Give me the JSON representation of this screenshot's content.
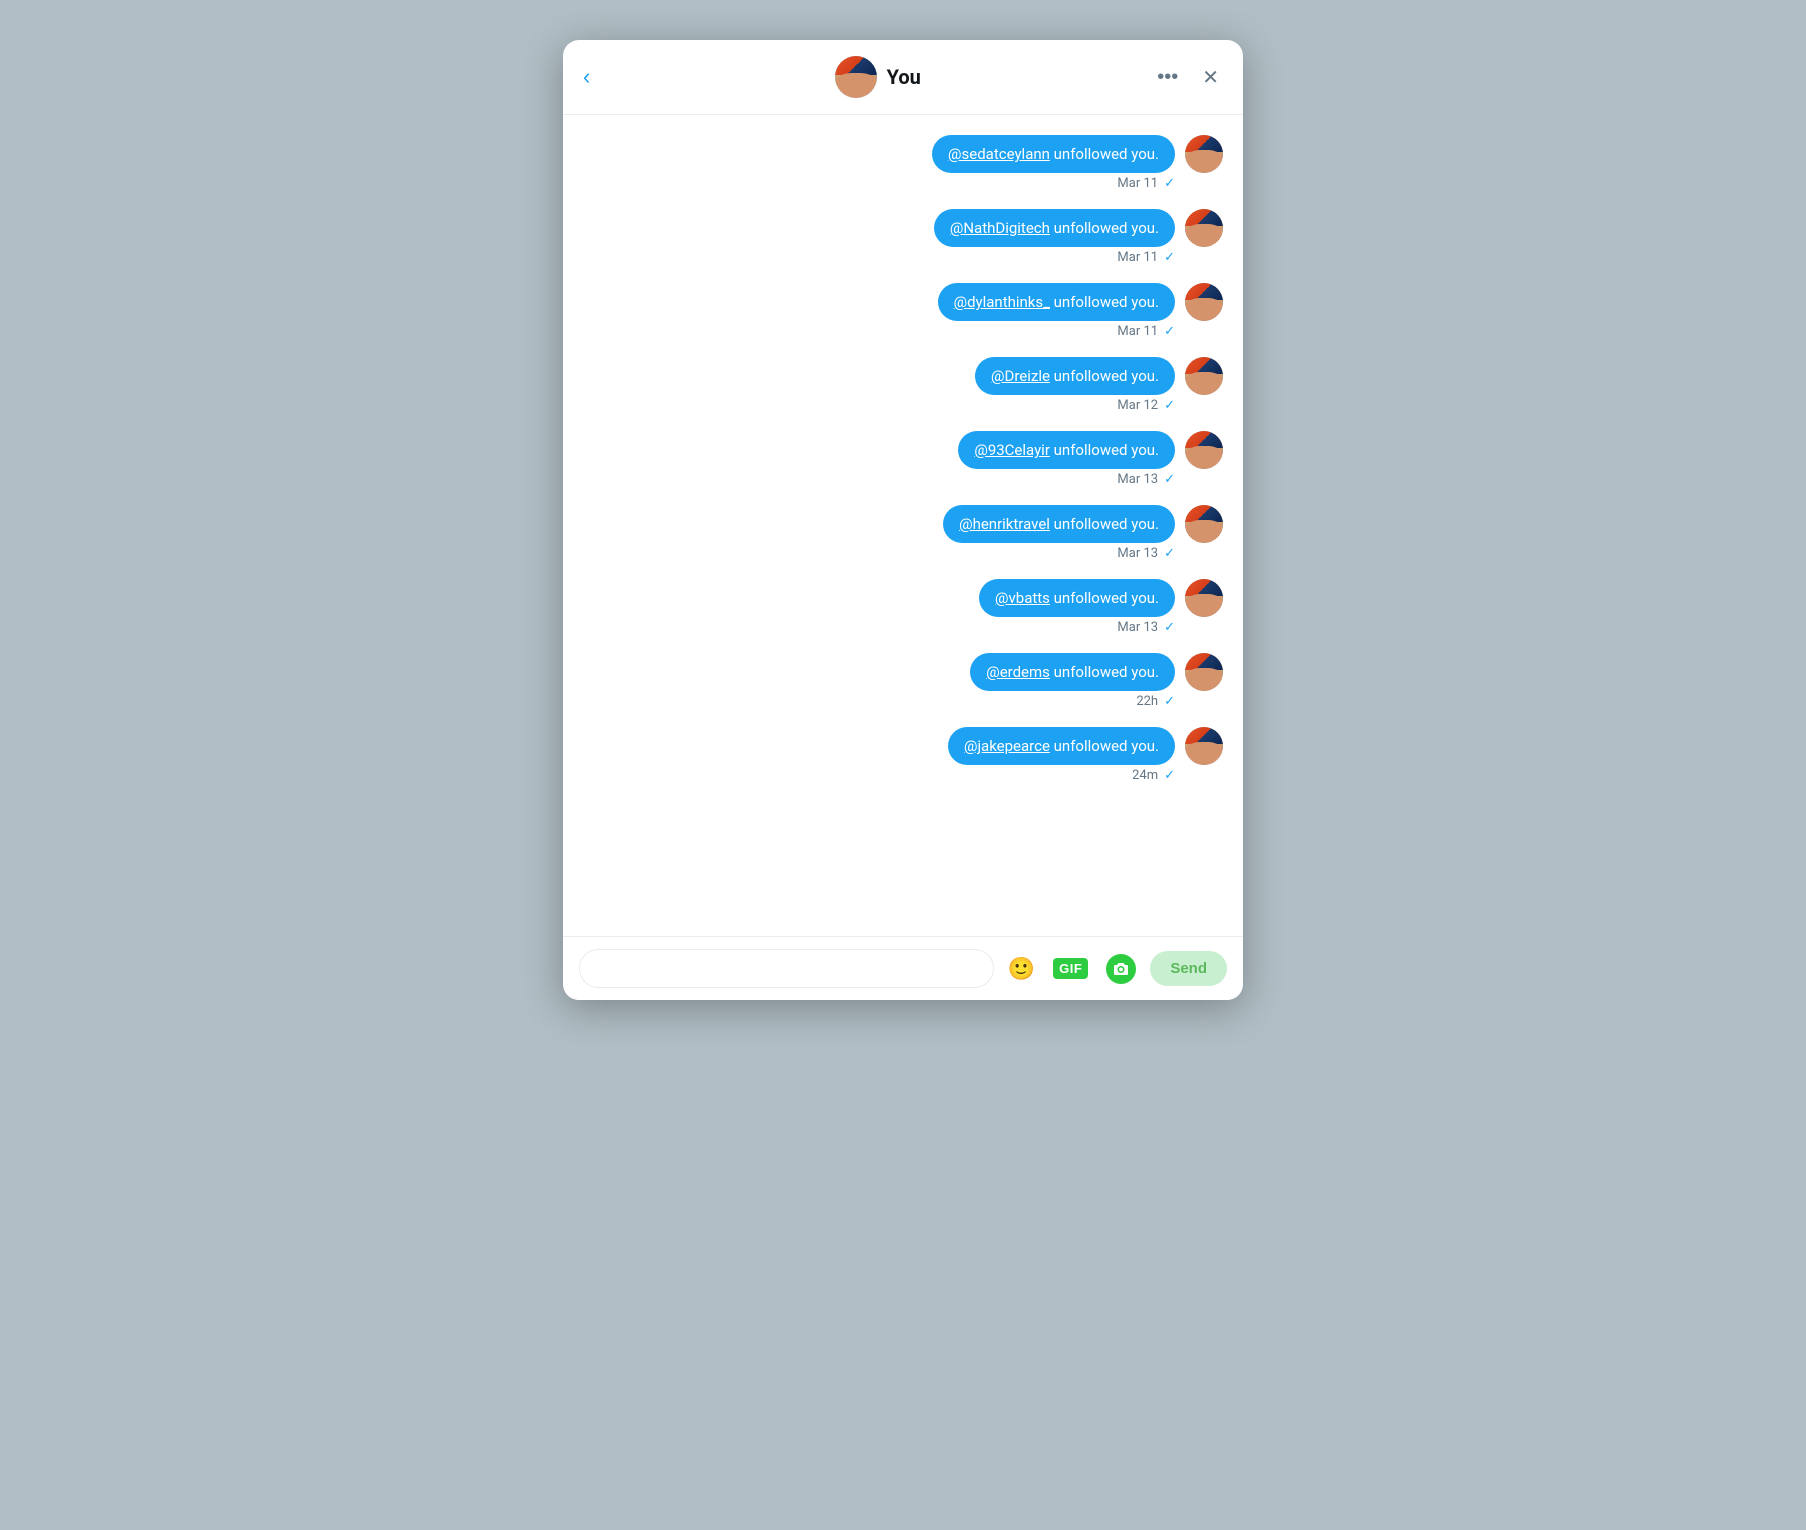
{
  "modal": {
    "title": "You",
    "back_label": "‹",
    "more_label": "•••",
    "close_label": "✕"
  },
  "messages": [
    {
      "id": 1,
      "text_pre": "@sedatceylann",
      "text_post": " unfollowed you.",
      "date": "Mar 11",
      "checked": true
    },
    {
      "id": 2,
      "text_pre": "@NathDigitech",
      "text_post": " unfollowed you.",
      "date": "Mar 11",
      "checked": true
    },
    {
      "id": 3,
      "text_pre": "@dylanthinks_",
      "text_post": " unfollowed you.",
      "date": "Mar 11",
      "checked": true
    },
    {
      "id": 4,
      "text_pre": "@Dreizle",
      "text_post": " unfollowed you.",
      "date": "Mar 12",
      "checked": true
    },
    {
      "id": 5,
      "text_pre": "@93Celayir",
      "text_post": " unfollowed you.",
      "date": "Mar 13",
      "checked": true
    },
    {
      "id": 6,
      "text_pre": "@henriktravel",
      "text_post": " unfollowed you.",
      "date": "Mar 13",
      "checked": true
    },
    {
      "id": 7,
      "text_pre": "@vbatts",
      "text_post": " unfollowed you.",
      "date": "Mar 13",
      "checked": true
    },
    {
      "id": 8,
      "text_pre": "@erdems",
      "text_post": " unfollowed you.",
      "date": "22h",
      "checked": true
    },
    {
      "id": 9,
      "text_pre": "@jakepearce",
      "text_post": " unfollowed you.",
      "date": "24m",
      "checked": true
    }
  ],
  "input": {
    "placeholder": "",
    "send_label": "Send",
    "gif_label": "GIF",
    "emoji_symbol": "😊"
  }
}
